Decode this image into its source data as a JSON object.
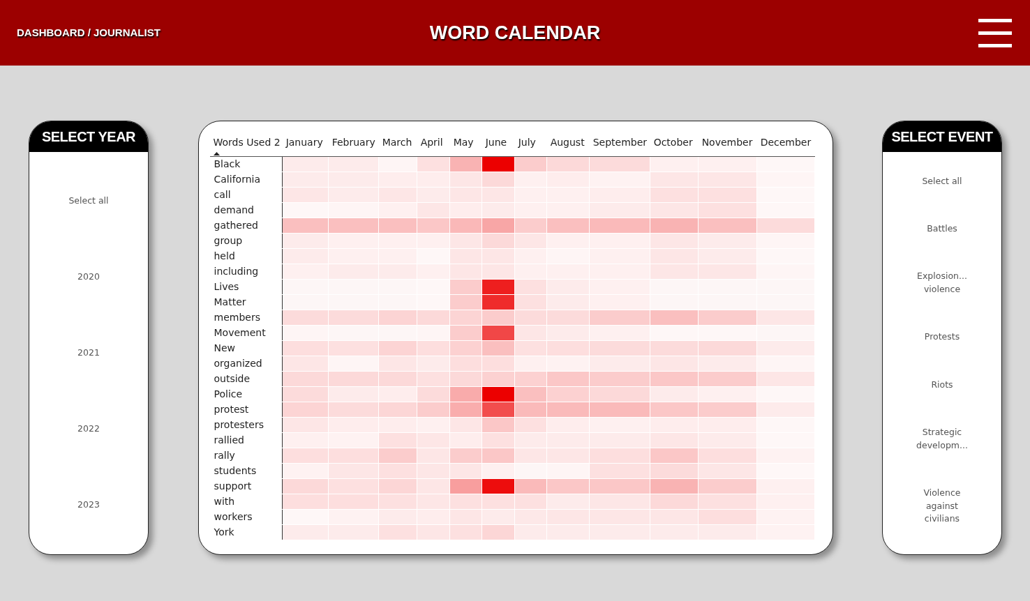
{
  "header": {
    "breadcrumb": "DASHBOARD / JOURNALIST",
    "title": "WORD CALENDAR"
  },
  "year_slicer": {
    "title": "SELECT YEAR",
    "items": [
      {
        "label": "Select all"
      },
      {
        "label": "2020"
      },
      {
        "label": "2021"
      },
      {
        "label": "2022"
      },
      {
        "label": "2023"
      }
    ]
  },
  "matrix": {
    "corner": "Words Used 2",
    "columns": [
      "January",
      "February",
      "March",
      "April",
      "May",
      "June",
      "July",
      "August",
      "September",
      "October",
      "November",
      "December"
    ],
    "rows": [
      {
        "word": "Black",
        "cells": [
          {
            "color": "#fdebeb"
          },
          {
            "color": "#fdebeb"
          },
          {
            "color": "#fef5f5"
          },
          {
            "color": "#fde0e0"
          },
          {
            "color": "#f9b3b3"
          },
          {
            "color": "#ec0000"
          },
          {
            "color": "#fbcccc"
          },
          {
            "color": "#fcd9d9"
          },
          {
            "color": "#fcdbdb"
          },
          {
            "color": "#fef0f0"
          },
          {
            "color": "#fef0f0"
          },
          {
            "color": "#fef7f7"
          }
        ]
      },
      {
        "word": "California",
        "cells": [
          {
            "color": "#fdebeb"
          },
          {
            "color": "#fdebeb"
          },
          {
            "color": "#feeded"
          },
          {
            "color": "#feeded"
          },
          {
            "color": "#fde6e6"
          },
          {
            "color": "#fcd9d9"
          },
          {
            "color": "#fef0f0"
          },
          {
            "color": "#feeded"
          },
          {
            "color": "#fef2f2"
          },
          {
            "color": "#fde6e6"
          },
          {
            "color": "#fde6e6"
          },
          {
            "color": "#fef5f5"
          }
        ]
      },
      {
        "word": "call",
        "cells": [
          {
            "color": "#fde6e6"
          },
          {
            "color": "#fdebeb"
          },
          {
            "color": "#fde6e6"
          },
          {
            "color": "#fdebeb"
          },
          {
            "color": "#fde6e6"
          },
          {
            "color": "#fde6e6"
          },
          {
            "color": "#fef0f0"
          },
          {
            "color": "#fef0f0"
          },
          {
            "color": "#feeded"
          },
          {
            "color": "#fde0e0"
          },
          {
            "color": "#fde0e0"
          },
          {
            "color": "#fef7f7"
          }
        ]
      },
      {
        "word": "demand",
        "cells": [
          {
            "color": "#fef7f7"
          },
          {
            "color": "#fef5f5"
          },
          {
            "color": "#fef0f0"
          },
          {
            "color": "#fde6e6"
          },
          {
            "color": "#feeded"
          },
          {
            "color": "#fdebeb"
          },
          {
            "color": "#fef0f0"
          },
          {
            "color": "#fef0f0"
          },
          {
            "color": "#fdebeb"
          },
          {
            "color": "#fde6e6"
          },
          {
            "color": "#fde0e0"
          },
          {
            "color": "#fef7f7"
          }
        ]
      },
      {
        "word": "gathered",
        "cells": [
          {
            "color": "#fabfbf"
          },
          {
            "color": "#fabfbf"
          },
          {
            "color": "#fabfbf"
          },
          {
            "color": "#fbc7c7"
          },
          {
            "color": "#fab8b8"
          },
          {
            "color": "#f8a6a6"
          },
          {
            "color": "#fbcccc"
          },
          {
            "color": "#fabfbf"
          },
          {
            "color": "#fababa"
          },
          {
            "color": "#f9b3b3"
          },
          {
            "color": "#fabfbf"
          },
          {
            "color": "#fcdbdb"
          }
        ]
      },
      {
        "word": "group",
        "cells": [
          {
            "color": "#fdebeb"
          },
          {
            "color": "#fef0f0"
          },
          {
            "color": "#fef0f0"
          },
          {
            "color": "#fef0f0"
          },
          {
            "color": "#fde6e6"
          },
          {
            "color": "#fcd9d9"
          },
          {
            "color": "#fde6e6"
          },
          {
            "color": "#fef0f0"
          },
          {
            "color": "#fef0f0"
          },
          {
            "color": "#fde6e6"
          },
          {
            "color": "#fdebeb"
          },
          {
            "color": "#fef5f5"
          }
        ]
      },
      {
        "word": "held",
        "cells": [
          {
            "color": "#fdebeb"
          },
          {
            "color": "#fef0f0"
          },
          {
            "color": "#fef0f0"
          },
          {
            "color": "#fef7f7"
          },
          {
            "color": "#fde6e6"
          },
          {
            "color": "#fde6e6"
          },
          {
            "color": "#fef0f0"
          },
          {
            "color": "#fef5f5"
          },
          {
            "color": "#fef0f0"
          },
          {
            "color": "#fde6e6"
          },
          {
            "color": "#fdebeb"
          },
          {
            "color": "#fef7f7"
          }
        ]
      },
      {
        "word": "including",
        "cells": [
          {
            "color": "#fef0f0"
          },
          {
            "color": "#fdebeb"
          },
          {
            "color": "#fdebeb"
          },
          {
            "color": "#fef0f0"
          },
          {
            "color": "#fde6e6"
          },
          {
            "color": "#fde6e6"
          },
          {
            "color": "#fef0f0"
          },
          {
            "color": "#fef0f0"
          },
          {
            "color": "#fef0f0"
          },
          {
            "color": "#fde6e6"
          },
          {
            "color": "#fde6e6"
          },
          {
            "color": "#fef5f5"
          }
        ]
      },
      {
        "word": "Lives",
        "cells": [
          {
            "color": "#fdf6f6"
          },
          {
            "color": "#fdf6f6"
          },
          {
            "color": "#fdf6f6"
          },
          {
            "color": "#fef7f7"
          },
          {
            "color": "#fbcccc"
          },
          {
            "color": "#ee1f1f"
          },
          {
            "color": "#fde0e0"
          },
          {
            "color": "#fdebeb"
          },
          {
            "color": "#fef0f0"
          },
          {
            "color": "#fdf6f6"
          },
          {
            "color": "#fdf6f6"
          },
          {
            "color": "#fdf6f6"
          }
        ]
      },
      {
        "word": "Matter",
        "cells": [
          {
            "color": "#fdf6f6"
          },
          {
            "color": "#fdf6f6"
          },
          {
            "color": "#fdf6f6"
          },
          {
            "color": "#fef7f7"
          },
          {
            "color": "#fbcccc"
          },
          {
            "color": "#ef2b2b"
          },
          {
            "color": "#fde0e0"
          },
          {
            "color": "#fdebeb"
          },
          {
            "color": "#fef0f0"
          },
          {
            "color": "#fdf6f6"
          },
          {
            "color": "#fdf6f6"
          },
          {
            "color": "#fdf6f6"
          }
        ]
      },
      {
        "word": "members",
        "cells": [
          {
            "color": "#fcdbdb"
          },
          {
            "color": "#fcdbdb"
          },
          {
            "color": "#fcd4d4"
          },
          {
            "color": "#fcd9d9"
          },
          {
            "color": "#fcd4d4"
          },
          {
            "color": "#fbcccc"
          },
          {
            "color": "#fcdbdb"
          },
          {
            "color": "#fcdbdb"
          },
          {
            "color": "#fbcccc"
          },
          {
            "color": "#fabfbf"
          },
          {
            "color": "#fbcccc"
          },
          {
            "color": "#fde6e6"
          }
        ]
      },
      {
        "word": "Movement",
        "cells": [
          {
            "color": "#fef5f5"
          },
          {
            "color": "#fdf6f6"
          },
          {
            "color": "#fdf6f6"
          },
          {
            "color": "#fef5f5"
          },
          {
            "color": "#fbcccc"
          },
          {
            "color": "#f14747"
          },
          {
            "color": "#fde6e6"
          },
          {
            "color": "#fdebeb"
          },
          {
            "color": "#fef0f0"
          },
          {
            "color": "#fef7f7"
          },
          {
            "color": "#fef7f7"
          },
          {
            "color": "#fdf6f6"
          }
        ]
      },
      {
        "word": "New",
        "cells": [
          {
            "color": "#fddede"
          },
          {
            "color": "#fde0e0"
          },
          {
            "color": "#fcd4d4"
          },
          {
            "color": "#fddede"
          },
          {
            "color": "#fcd1d1"
          },
          {
            "color": "#fabfbf"
          },
          {
            "color": "#fde0e0"
          },
          {
            "color": "#fddede"
          },
          {
            "color": "#fcdbdb"
          },
          {
            "color": "#fcdbdb"
          },
          {
            "color": "#fcd9d9"
          },
          {
            "color": "#fdebeb"
          }
        ]
      },
      {
        "word": "organized",
        "cells": [
          {
            "color": "#fde6e6"
          },
          {
            "color": "#fef5f5"
          },
          {
            "color": "#fde6e6"
          },
          {
            "color": "#fdebeb"
          },
          {
            "color": "#fddede"
          },
          {
            "color": "#fddede"
          },
          {
            "color": "#fef0f0"
          },
          {
            "color": "#fef2f2"
          },
          {
            "color": "#fdebeb"
          },
          {
            "color": "#fde6e6"
          },
          {
            "color": "#fdebeb"
          },
          {
            "color": "#fef5f5"
          }
        ]
      },
      {
        "word": "outside",
        "cells": [
          {
            "color": "#fcd9d9"
          },
          {
            "color": "#fcd9d9"
          },
          {
            "color": "#fcd9d9"
          },
          {
            "color": "#fde0e0"
          },
          {
            "color": "#fcd9d9"
          },
          {
            "color": "#fcd1d1"
          },
          {
            "color": "#fcd1d1"
          },
          {
            "color": "#fbc7c7"
          },
          {
            "color": "#fbcccc"
          },
          {
            "color": "#fbc7c7"
          },
          {
            "color": "#fbcccc"
          },
          {
            "color": "#fde6e6"
          }
        ]
      },
      {
        "word": "Police",
        "cells": [
          {
            "color": "#fcdbdb"
          },
          {
            "color": "#fdebeb"
          },
          {
            "color": "#feeded"
          },
          {
            "color": "#fcdbdb"
          },
          {
            "color": "#f9abab"
          },
          {
            "color": "#ec0000"
          },
          {
            "color": "#fabfbf"
          },
          {
            "color": "#fcd1d1"
          },
          {
            "color": "#fcd9d9"
          },
          {
            "color": "#fdebeb"
          },
          {
            "color": "#fef0f0"
          },
          {
            "color": "#fef7f7"
          }
        ]
      },
      {
        "word": "protest",
        "cells": [
          {
            "color": "#fcd4d4"
          },
          {
            "color": "#fcdbdb"
          },
          {
            "color": "#fcd6d6"
          },
          {
            "color": "#fbcccc"
          },
          {
            "color": "#f9adad"
          },
          {
            "color": "#f24d4d"
          },
          {
            "color": "#fababa"
          },
          {
            "color": "#fababa"
          },
          {
            "color": "#fababa"
          },
          {
            "color": "#fbc7c7"
          },
          {
            "color": "#fbcccc"
          },
          {
            "color": "#fdebeb"
          }
        ]
      },
      {
        "word": "protesters",
        "cells": [
          {
            "color": "#fde6e6"
          },
          {
            "color": "#feeded"
          },
          {
            "color": "#feeded"
          },
          {
            "color": "#fef0f0"
          },
          {
            "color": "#fde6e6"
          },
          {
            "color": "#fbc7c7"
          },
          {
            "color": "#fde0e0"
          },
          {
            "color": "#feeded"
          },
          {
            "color": "#fef0f0"
          },
          {
            "color": "#feeded"
          },
          {
            "color": "#feeded"
          },
          {
            "color": "#fef7f7"
          }
        ]
      },
      {
        "word": "rallied",
        "cells": [
          {
            "color": "#fef0f0"
          },
          {
            "color": "#fef2f2"
          },
          {
            "color": "#fde0e0"
          },
          {
            "color": "#fde6e6"
          },
          {
            "color": "#feeded"
          },
          {
            "color": "#fde0e0"
          },
          {
            "color": "#fdebeb"
          },
          {
            "color": "#fdebeb"
          },
          {
            "color": "#fdebeb"
          },
          {
            "color": "#fde6e6"
          },
          {
            "color": "#fdebeb"
          },
          {
            "color": "#fef7f7"
          }
        ]
      },
      {
        "word": "rally",
        "cells": [
          {
            "color": "#fddede"
          },
          {
            "color": "#fddede"
          },
          {
            "color": "#fbcccc"
          },
          {
            "color": "#fde6e6"
          },
          {
            "color": "#fbcccc"
          },
          {
            "color": "#fbc7c7"
          },
          {
            "color": "#fde6e6"
          },
          {
            "color": "#fde6e6"
          },
          {
            "color": "#fddede"
          },
          {
            "color": "#fbc7c7"
          },
          {
            "color": "#fddede"
          },
          {
            "color": "#fef2f2"
          }
        ]
      },
      {
        "word": "students",
        "cells": [
          {
            "color": "#fef2f2"
          },
          {
            "color": "#fde6e6"
          },
          {
            "color": "#fde0e0"
          },
          {
            "color": "#fde6e6"
          },
          {
            "color": "#fde6e6"
          },
          {
            "color": "#fef0f0"
          },
          {
            "color": "#fdf6f6"
          },
          {
            "color": "#fef5f5"
          },
          {
            "color": "#fde0e0"
          },
          {
            "color": "#fcdbdb"
          },
          {
            "color": "#fde6e6"
          },
          {
            "color": "#fef7f7"
          }
        ]
      },
      {
        "word": "support",
        "cells": [
          {
            "color": "#fcd9d9"
          },
          {
            "color": "#fde0e0"
          },
          {
            "color": "#fcd6d6"
          },
          {
            "color": "#fde6e6"
          },
          {
            "color": "#f89e9e"
          },
          {
            "color": "#ed0d0d"
          },
          {
            "color": "#fababa"
          },
          {
            "color": "#fbc7c7"
          },
          {
            "color": "#fbc7c7"
          },
          {
            "color": "#f9b3b3"
          },
          {
            "color": "#fbcccc"
          },
          {
            "color": "#fef0f0"
          }
        ]
      },
      {
        "word": "with",
        "cells": [
          {
            "color": "#fddede"
          },
          {
            "color": "#fddede"
          },
          {
            "color": "#fde0e0"
          },
          {
            "color": "#fde6e6"
          },
          {
            "color": "#fde0e0"
          },
          {
            "color": "#fde0e0"
          },
          {
            "color": "#fde0e0"
          },
          {
            "color": "#fdebeb"
          },
          {
            "color": "#fde6e6"
          },
          {
            "color": "#fcd9d9"
          },
          {
            "color": "#fde0e0"
          },
          {
            "color": "#fef0f0"
          }
        ]
      },
      {
        "word": "workers",
        "cells": [
          {
            "color": "#fef7f7"
          },
          {
            "color": "#fef2f2"
          },
          {
            "color": "#fdebeb"
          },
          {
            "color": "#feeded"
          },
          {
            "color": "#fde6e6"
          },
          {
            "color": "#fdebeb"
          },
          {
            "color": "#fde8e8"
          },
          {
            "color": "#fde6e6"
          },
          {
            "color": "#fde6e6"
          },
          {
            "color": "#fde6e6"
          },
          {
            "color": "#fddede"
          },
          {
            "color": "#fef2f2"
          }
        ]
      },
      {
        "word": "York",
        "cells": [
          {
            "color": "#fdebeb"
          },
          {
            "color": "#fdebeb"
          },
          {
            "color": "#fde0e0"
          },
          {
            "color": "#fde6e6"
          },
          {
            "color": "#fde0e0"
          },
          {
            "color": "#fcd6d6"
          },
          {
            "color": "#fdebeb"
          },
          {
            "color": "#fdebeb"
          },
          {
            "color": "#fdebeb"
          },
          {
            "color": "#fdebeb"
          },
          {
            "color": "#fdebeb"
          },
          {
            "color": "#fef2f2"
          }
        ]
      }
    ]
  },
  "event_slicer": {
    "title": "SELECT EVENT",
    "items": [
      {
        "label": "Select all"
      },
      {
        "label": "Battles"
      },
      {
        "label": "Explosion...\nviolence"
      },
      {
        "label": "Protests"
      },
      {
        "label": "Riots"
      },
      {
        "label": "Strategic\ndevelopm..."
      },
      {
        "label": "Violence\nagainst\ncivilians"
      }
    ]
  }
}
